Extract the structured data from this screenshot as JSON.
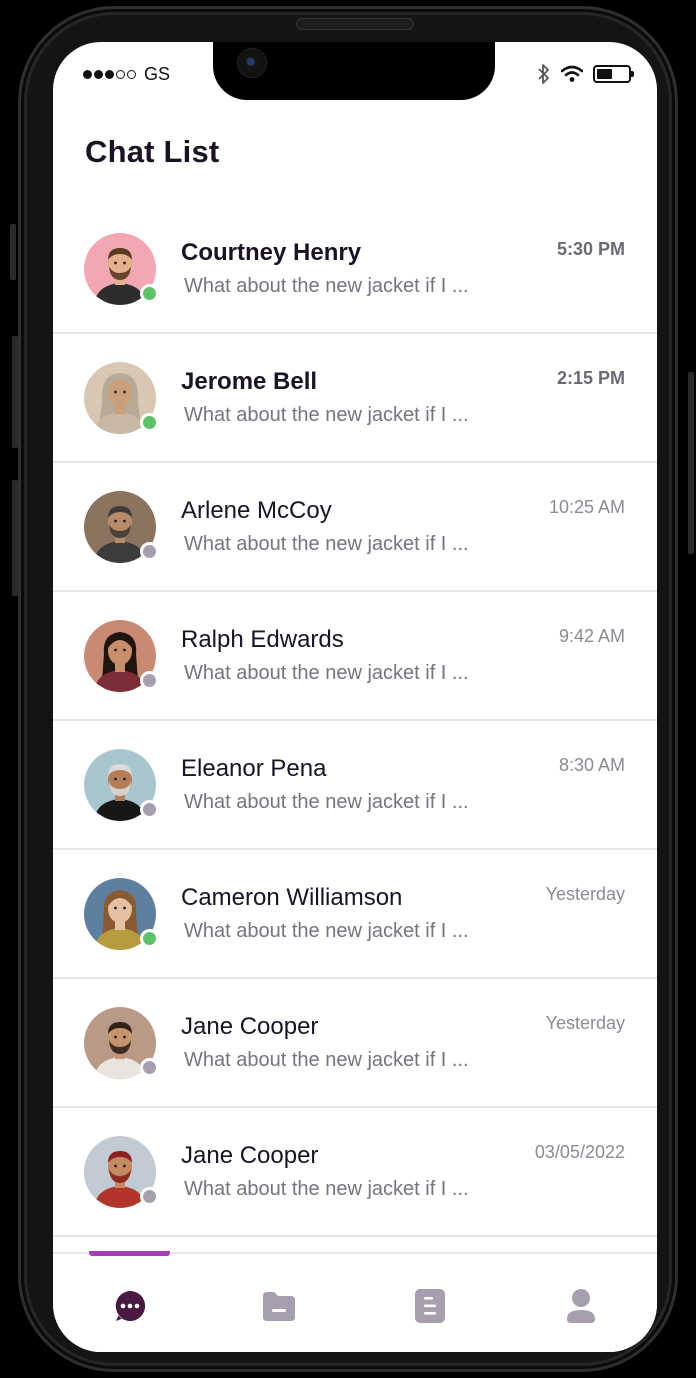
{
  "status_bar": {
    "carrier": "GS",
    "signal_bars_filled": 3,
    "signal_bars_total": 5,
    "battery_level": 0.5
  },
  "page": {
    "title": "Chat List"
  },
  "chats": [
    {
      "name": "Courtney Henry",
      "preview": "What about the new jacket if I ...",
      "time": "5:30 PM",
      "unread": true,
      "online": true
    },
    {
      "name": "Jerome Bell",
      "preview": "What about the new jacket if I ...",
      "time": "2:15 PM",
      "unread": true,
      "online": true
    },
    {
      "name": "Arlene McCoy",
      "preview": "What about the new jacket if I ...",
      "time": "10:25 AM",
      "unread": false,
      "online": false
    },
    {
      "name": "Ralph Edwards",
      "preview": "What about the new jacket if I ...",
      "time": "9:42 AM",
      "unread": false,
      "online": false
    },
    {
      "name": "Eleanor Pena",
      "preview": "What about the new jacket if I ...",
      "time": "8:30 AM",
      "unread": false,
      "online": false
    },
    {
      "name": "Cameron Williamson",
      "preview": "What about the new jacket if I ...",
      "time": "Yesterday",
      "unread": false,
      "online": true
    },
    {
      "name": "Jane Cooper",
      "preview": "What about the new jacket if I ...",
      "time": "Yesterday",
      "unread": false,
      "online": false
    },
    {
      "name": "Jane Cooper",
      "preview": "What about the new jacket if I ...",
      "time": "03/05/2022",
      "unread": false,
      "online": false
    }
  ],
  "bottom_nav": {
    "items": [
      {
        "icon": "chat-bubble-icon",
        "active": true
      },
      {
        "icon": "folder-icon",
        "active": false
      },
      {
        "icon": "document-icon",
        "active": false
      },
      {
        "icon": "profile-icon",
        "active": false
      }
    ]
  },
  "colors": {
    "online": "#5fc26a",
    "offline": "#a79eaf",
    "accent": "#a63db6",
    "active_icon": "#4a1942",
    "inactive_icon": "#a79eaf",
    "title_text": "#1a1324"
  }
}
